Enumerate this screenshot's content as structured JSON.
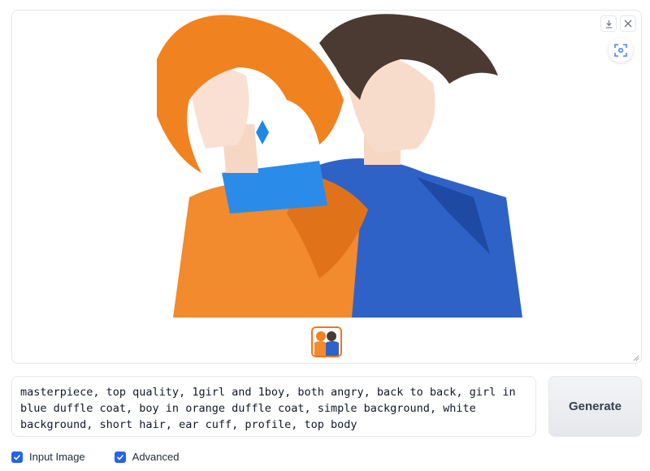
{
  "gallery": {
    "download_icon": "download-icon",
    "close_icon": "close-icon",
    "fullscreen_icon": "focus-frame-icon",
    "thumbnail_selected": true
  },
  "prompt": {
    "value": "masterpiece, top quality, 1girl and 1boy, both angry, back to back, girl in blue duffle coat, boy in orange duffle coat, simple background, white background, short hair, ear cuff, profile, top body"
  },
  "generate_label": "Generate",
  "options": {
    "input_image_label": "Input Image",
    "input_image_checked": true,
    "advanced_label": "Advanced",
    "advanced_checked": true
  },
  "colors": {
    "accent": "#2563eb",
    "thumb_border": "#f97316"
  }
}
